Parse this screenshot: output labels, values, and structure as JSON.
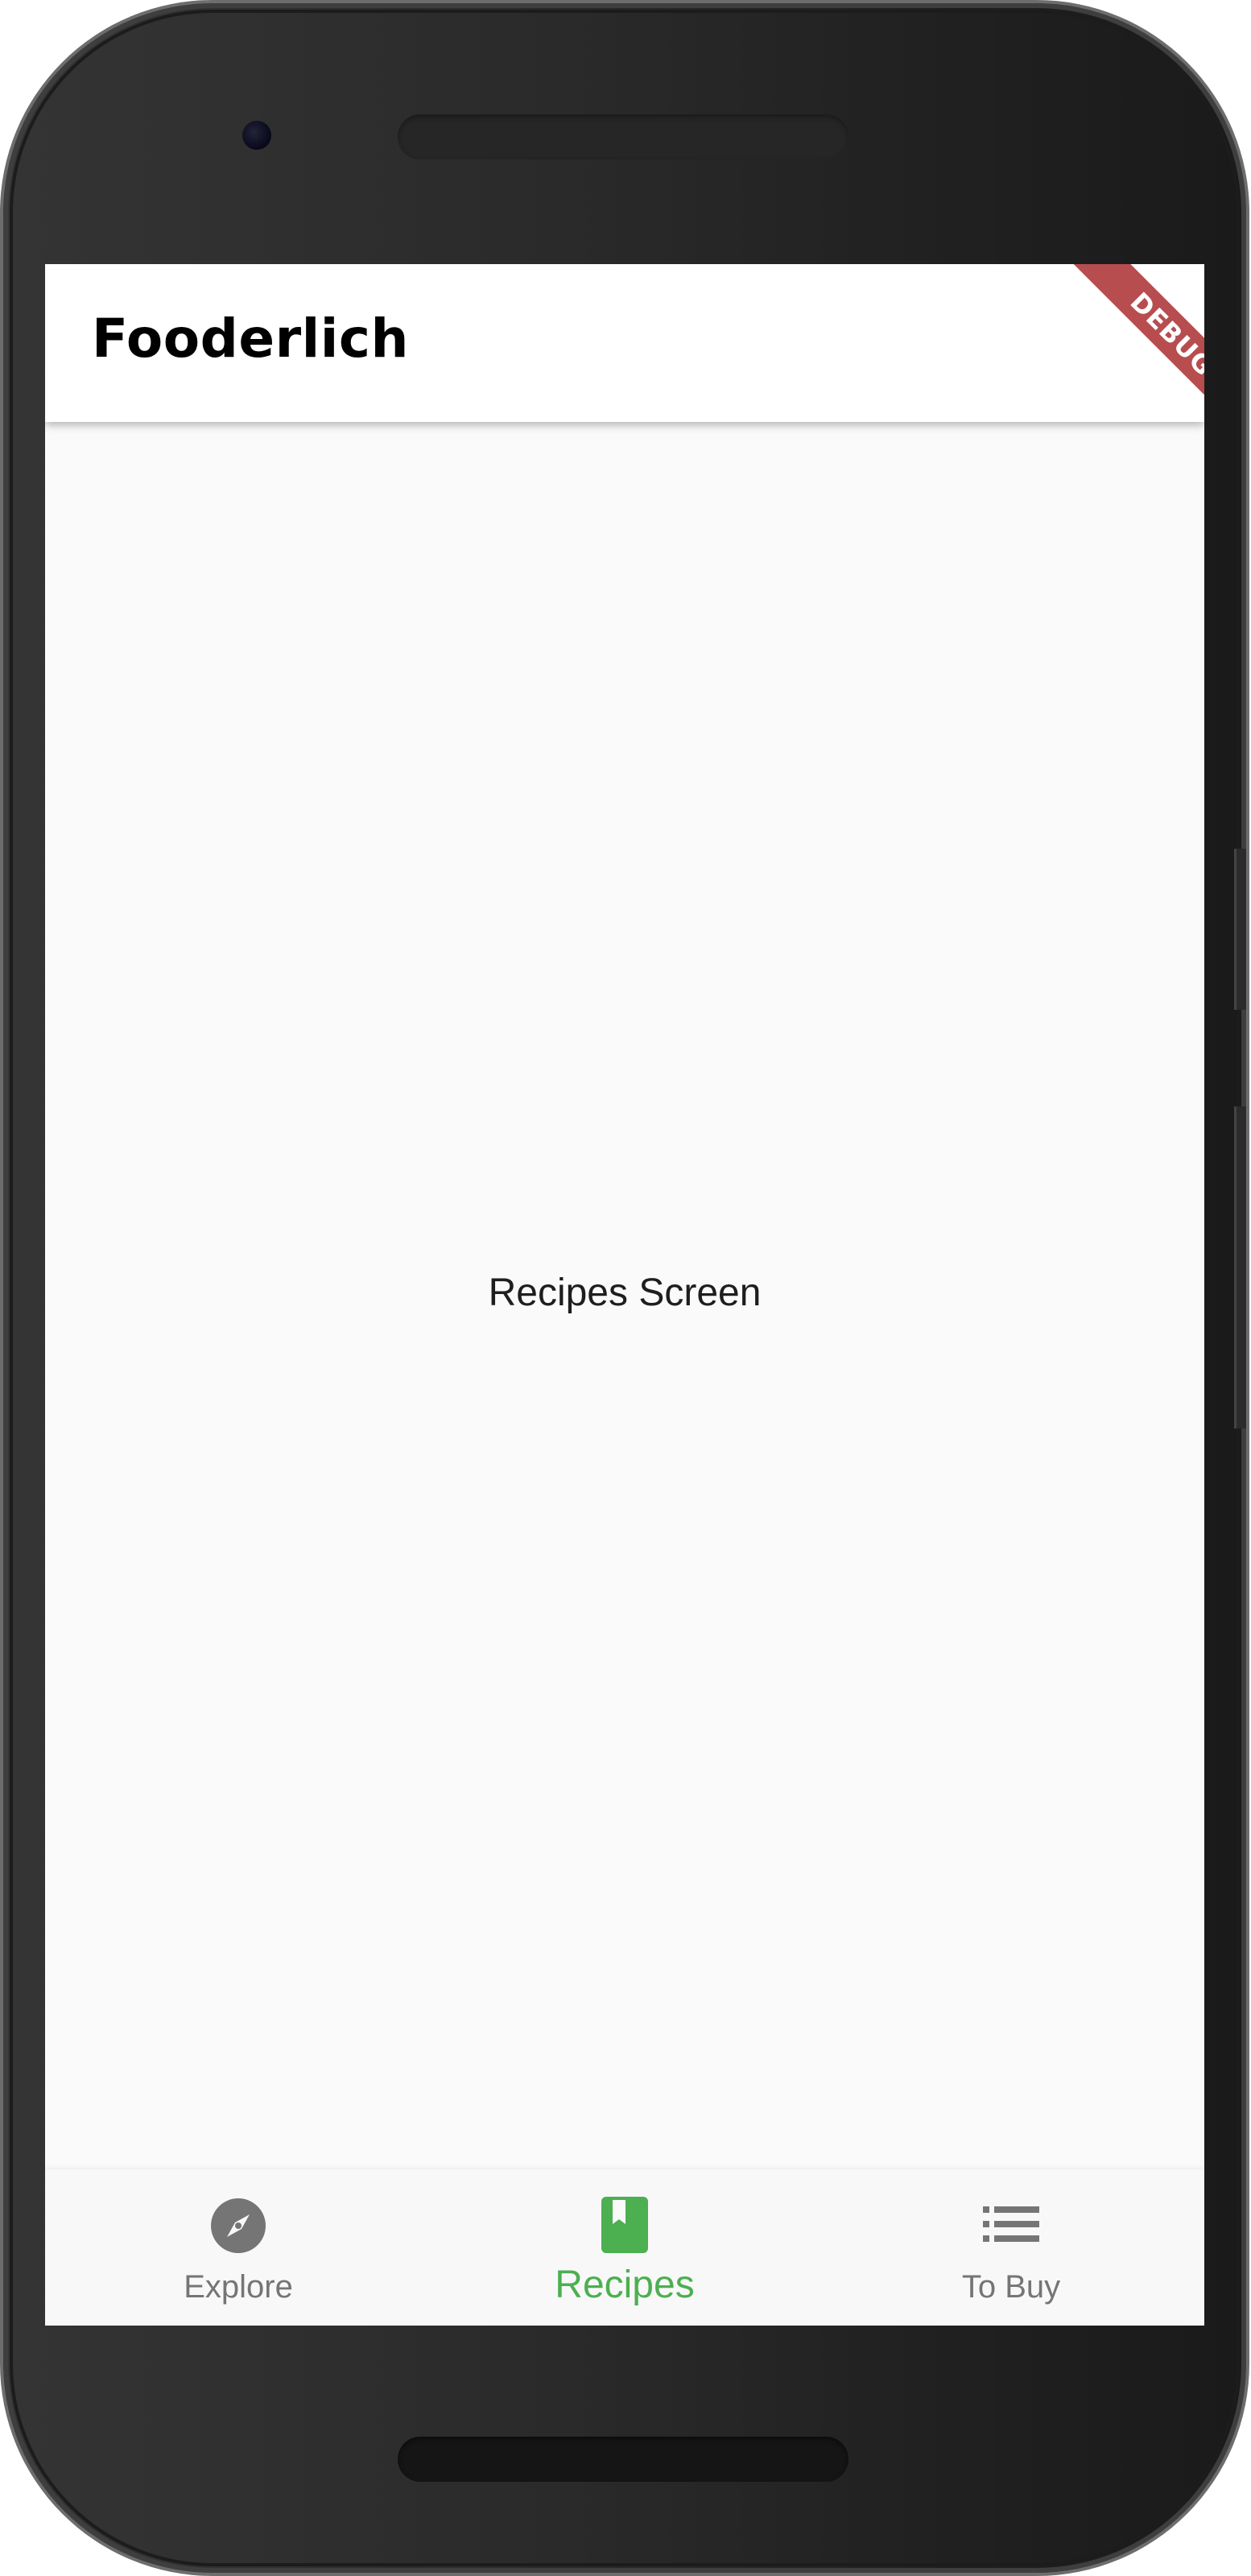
{
  "app_bar": {
    "title": "Fooderlich"
  },
  "debug_banner": {
    "label": "DEBUG",
    "color": "#b74d4f"
  },
  "body": {
    "text": "Recipes Screen"
  },
  "bottom_nav": {
    "items": [
      {
        "label": "Explore",
        "icon": "explore-compass-icon",
        "active": false
      },
      {
        "label": "Recipes",
        "icon": "book-icon",
        "active": true
      },
      {
        "label": "To Buy",
        "icon": "list-icon",
        "active": false
      }
    ],
    "active_color": "#4caf50",
    "inactive_color": "#757575"
  }
}
